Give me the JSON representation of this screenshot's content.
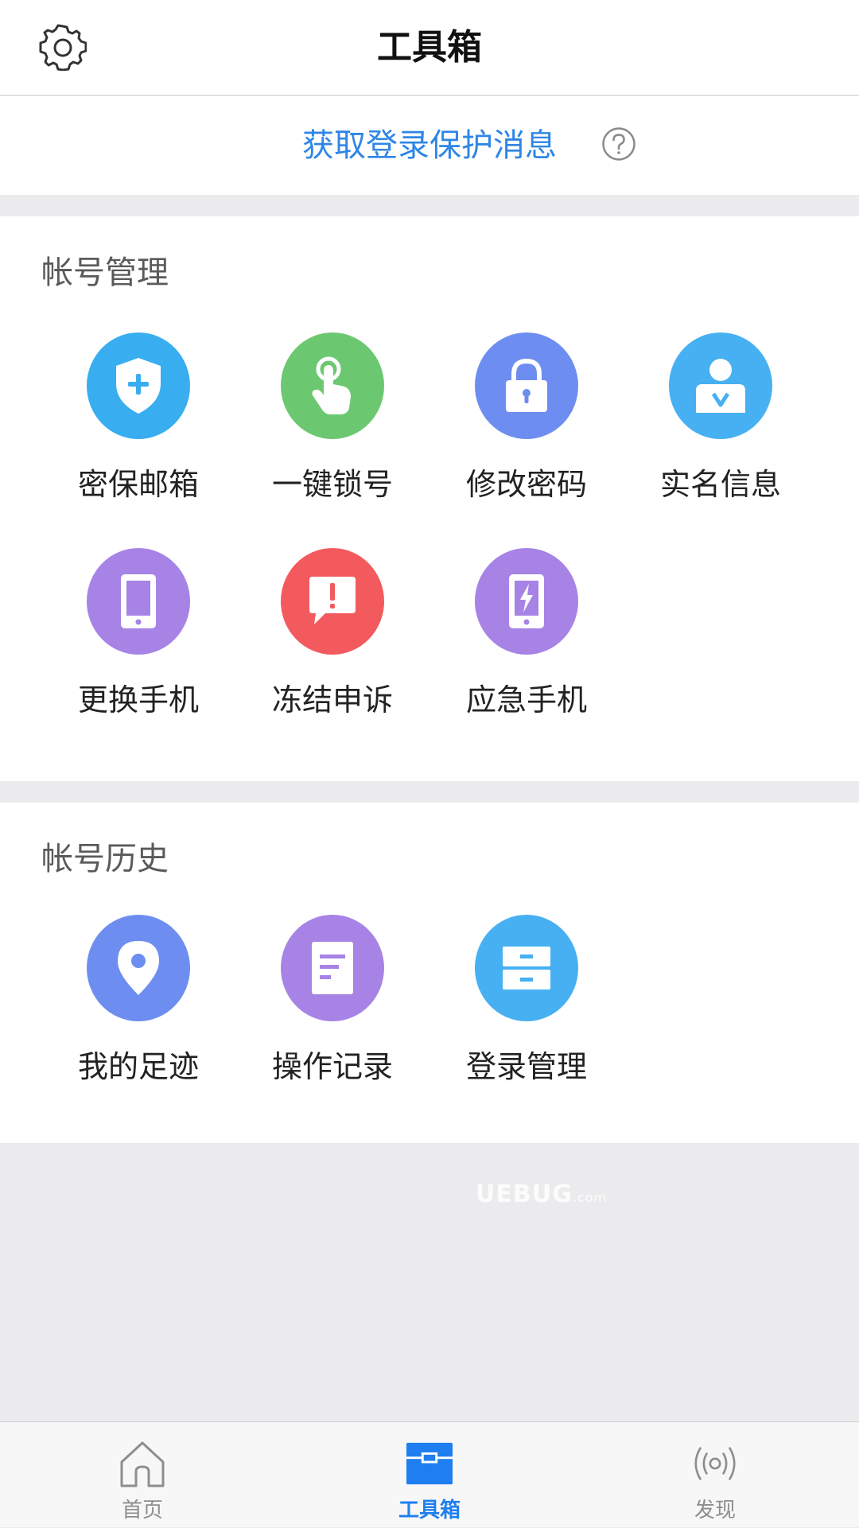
{
  "header": {
    "title": "工具箱",
    "settings_icon": "gear-icon"
  },
  "protect_bar": {
    "link_text": "获取登录保护消息",
    "help_icon": "question-circle-icon"
  },
  "account_section": {
    "title": "帐号管理",
    "items": [
      {
        "label": "密保邮箱",
        "icon": "shield-plus-icon",
        "color": "#38aef0"
      },
      {
        "label": "一键锁号",
        "icon": "tap-finger-icon",
        "color": "#6cc870"
      },
      {
        "label": "修改密码",
        "icon": "padlock-icon",
        "color": "#6d8ef0"
      },
      {
        "label": "实名信息",
        "icon": "verified-user-icon",
        "color": "#46b0f2"
      },
      {
        "label": "更换手机",
        "icon": "phone-icon",
        "color": "#a783e6"
      },
      {
        "label": "冻结申诉",
        "icon": "alert-bubble-icon",
        "color": "#f35a5d"
      },
      {
        "label": "应急手机",
        "icon": "phone-lightning-icon",
        "color": "#a783e6"
      }
    ]
  },
  "history_section": {
    "title": "帐号历史",
    "items": [
      {
        "label": "我的足迹",
        "icon": "location-pin-icon",
        "color": "#6d8ef0"
      },
      {
        "label": "操作记录",
        "icon": "document-icon",
        "color": "#a783e6"
      },
      {
        "label": "登录管理",
        "icon": "drawer-icon",
        "color": "#46b0f2"
      }
    ]
  },
  "watermark": {
    "text": "UEBUG",
    "suffix": ".com"
  },
  "tabbar": {
    "tabs": [
      {
        "label": "首页",
        "icon": "home-icon",
        "active": false
      },
      {
        "label": "工具箱",
        "icon": "toolbox-icon",
        "active": true
      },
      {
        "label": "发现",
        "icon": "broadcast-icon",
        "active": false
      }
    ]
  },
  "colors": {
    "accent": "#2f86e6",
    "tab_active": "#1f7ff0",
    "tab_inactive": "#8e8e8e",
    "background": "#ebebed"
  }
}
